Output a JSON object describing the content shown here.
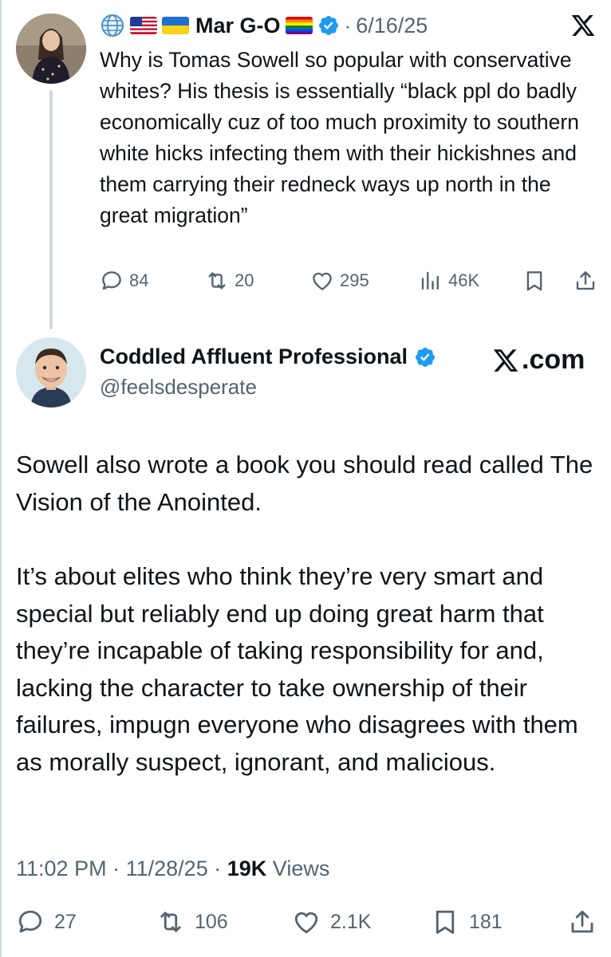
{
  "parent_tweet": {
    "prefix_icons": [
      "globe-icon",
      "us-flag-icon",
      "ukraine-flag-icon"
    ],
    "author_name": "Mar G-O",
    "name_suffix_icons": [
      "rainbow-flag-icon",
      "verified-badge-icon"
    ],
    "separator": "·",
    "date": "6/16/25",
    "text": "Why is Tomas Sowell so popular with conservative whites? His thesis is essentially “black ppl do badly economically cuz of too much proximity to southern white hicks infecting them with their hickishnes and them carrying their redneck ways up north in the great migration”",
    "actions": {
      "replies": "84",
      "reposts": "20",
      "likes": "295",
      "views": "46K"
    }
  },
  "main_tweet": {
    "author_name": "Coddled Affluent Professional",
    "handle": "@feelsdesperate",
    "watermark": ".com",
    "paragraphs": [
      "Sowell also wrote a book you should read called The Vision of the Anointed.",
      "It’s about elites who think they’re very smart and special but reliably end up doing great harm that they’re incapable of taking responsibility for and, lacking the character to take ownership of their failures, impugn everyone who disagrees with them as morally suspect, ignorant, and malicious."
    ],
    "time": "11:02 PM",
    "date": "11/28/25",
    "separator": "·",
    "views_count": "19K",
    "views_label": "Views",
    "actions": {
      "replies": "27",
      "reposts": "106",
      "likes": "2.1K",
      "bookmarks": "181"
    }
  },
  "colors": {
    "text_primary": "#0f1419",
    "text_secondary": "#536471",
    "verified_blue": "#1d9bf0",
    "divider": "#cfd9de"
  }
}
